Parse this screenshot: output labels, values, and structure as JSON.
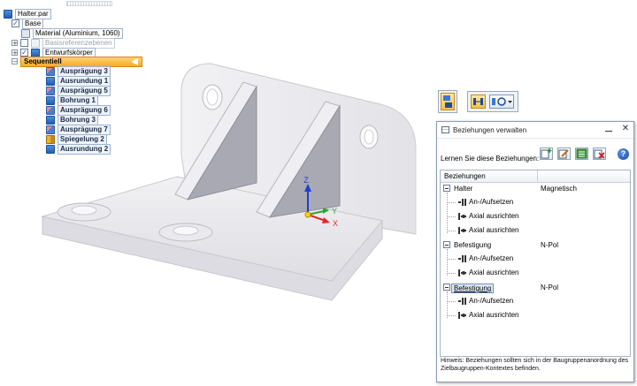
{
  "tree": {
    "root": "Halter.par",
    "base": "Base",
    "material": "Material (Aluminium, 1060)",
    "ref_planes": "Basisreferenzebenen",
    "design_body": "Entwurfskörper",
    "sequential": "Sequentiell",
    "features": [
      "Ausprägung 3",
      "Ausrundung 1",
      "Ausprägung 5",
      "Bohrung 1",
      "Ausprägung 6",
      "Bohrung 3",
      "Ausprägung 7",
      "Spiegelung 2",
      "Ausrundung 2"
    ],
    "expanders": {
      "root": "−",
      "ref": "+",
      "body": "+",
      "seq": "−"
    }
  },
  "triad": {
    "x": "X",
    "y": "Y",
    "z": "Z",
    "color_x": "#e0282b",
    "color_y": "#2aa62a",
    "color_z": "#1d3fd0"
  },
  "dialog": {
    "title": "Beziehungen verwalten",
    "learn_label": "Lernen Sie diese Beziehungen:",
    "help_glyph": "?",
    "close_glyph": "✕",
    "table_header": "Beziehungen",
    "groups": [
      {
        "name": "Halter",
        "type": "Magnetisch",
        "children": [
          "An-/Aufsetzen",
          "Axial ausrichten",
          "Axial ausrichten"
        ]
      },
      {
        "name": "Befestigung",
        "type": "N-Pol",
        "children": [
          "An-/Aufsetzen",
          "Axial ausrichten"
        ]
      },
      {
        "name": "Befestigung",
        "type": "N-Pol",
        "children": [
          "An-/Aufsetzen",
          "Axial ausrichten"
        ]
      }
    ],
    "hint": "Hinweis: Beziehungen sollten sich in der Baugruppenanordnung des Zielbaugruppen-Kontextes befinden."
  },
  "colors": {
    "accent": "#f7a931",
    "selection": "#dfe9f7",
    "part_face": "#ececf0",
    "rib_face": "#a9a9b3"
  }
}
